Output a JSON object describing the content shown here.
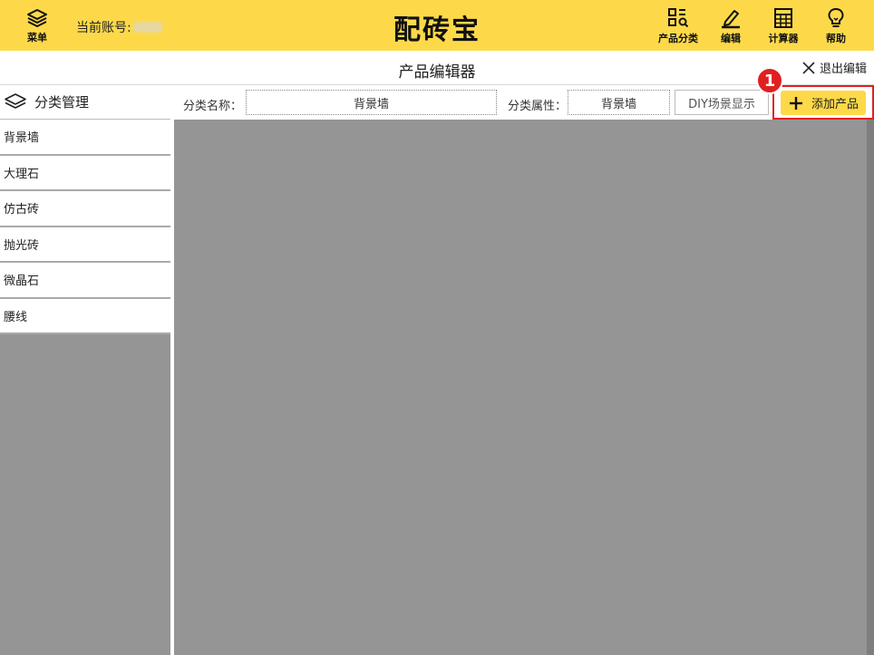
{
  "header": {
    "menu_label": "菜单",
    "account_label": "当前账号:",
    "logo": "配砖宝",
    "tools": [
      {
        "label": "产品分类",
        "icon": "category-search-icon"
      },
      {
        "label": "编辑",
        "icon": "pencil-icon"
      },
      {
        "label": "计算器",
        "icon": "calculator-icon"
      },
      {
        "label": "帮助",
        "icon": "lightbulb-icon"
      }
    ]
  },
  "titlebar": {
    "title": "产品编辑器",
    "exit_label": "退出编辑"
  },
  "sidebar": {
    "header": "分类管理",
    "items": [
      "背景墙",
      "大理石",
      "仿古砖",
      "抛光砖",
      "微晶石",
      "腰线"
    ]
  },
  "toolbar": {
    "category_name_label": "分类名称：",
    "category_name_value": "背景墙",
    "category_attr_label": "分类属性：",
    "category_attr_value": "背景墙",
    "diy_label": "DIY场景显示",
    "add_label": "添加产品"
  },
  "annotation": {
    "badge": "1"
  },
  "colors": {
    "brand_yellow": "#FDD94A",
    "highlight_red": "#E02020",
    "panel_gray": "#959595"
  }
}
